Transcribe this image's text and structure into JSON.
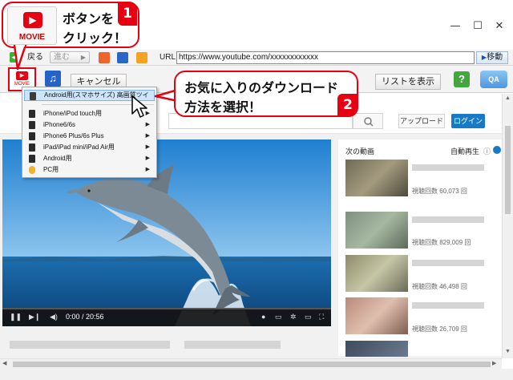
{
  "window": {
    "min_glyph": "—",
    "max_glyph": "☐",
    "close_glyph": "✕"
  },
  "toolbar": {
    "back_label": "戻る",
    "forward_label": "進む",
    "url_label": "URL",
    "url_value": "https://www.youtube.com/xxxxxxxxxxxx",
    "go_label": "移動",
    "movie_label": "MOVIE",
    "cancel_label": "キャンセル",
    "list_label": "リストを表示",
    "help_label": "?",
    "qa_label": "QA"
  },
  "context_menu": {
    "items": [
      {
        "label": "Android用(スマホサイズ) 高画質ツイ",
        "highlighted": true,
        "submenu": false
      },
      {
        "label": "iPhone/iPod touch用",
        "submenu": true
      },
      {
        "label": "iPhone6/6s",
        "submenu": true
      },
      {
        "label": "iPhone6 Plus/6s Plus",
        "submenu": true
      },
      {
        "label": "iPad/iPad mini/iPad Air用",
        "submenu": true
      },
      {
        "label": "Android用",
        "submenu": true
      },
      {
        "label": "PC用",
        "submenu": true
      }
    ]
  },
  "youtube": {
    "upload_label": "アップロード",
    "login_label": "ログイン",
    "next_label": "次の動画",
    "autoplay_label": "自動再生",
    "time_label": "0:00 / 20:56",
    "videos": [
      {
        "views": "視聴回数 60,073 回"
      },
      {
        "views": "視聴回数 829,009 回"
      },
      {
        "views": "視聴回数 46,498 回"
      },
      {
        "views": "視聴回数 26,709 回"
      }
    ]
  },
  "callout1": {
    "line1": "ボタンを",
    "line2": "クリック！",
    "step": "1",
    "icon_label": "MOVIE"
  },
  "callout2": {
    "line1": "お気に入りのダウンロード",
    "line2": "方法を選択！",
    "step": "2"
  },
  "colors": {
    "accent_red": "#e60012",
    "login_blue": "#167ac6",
    "menu_highlight": "#cde4fa"
  }
}
